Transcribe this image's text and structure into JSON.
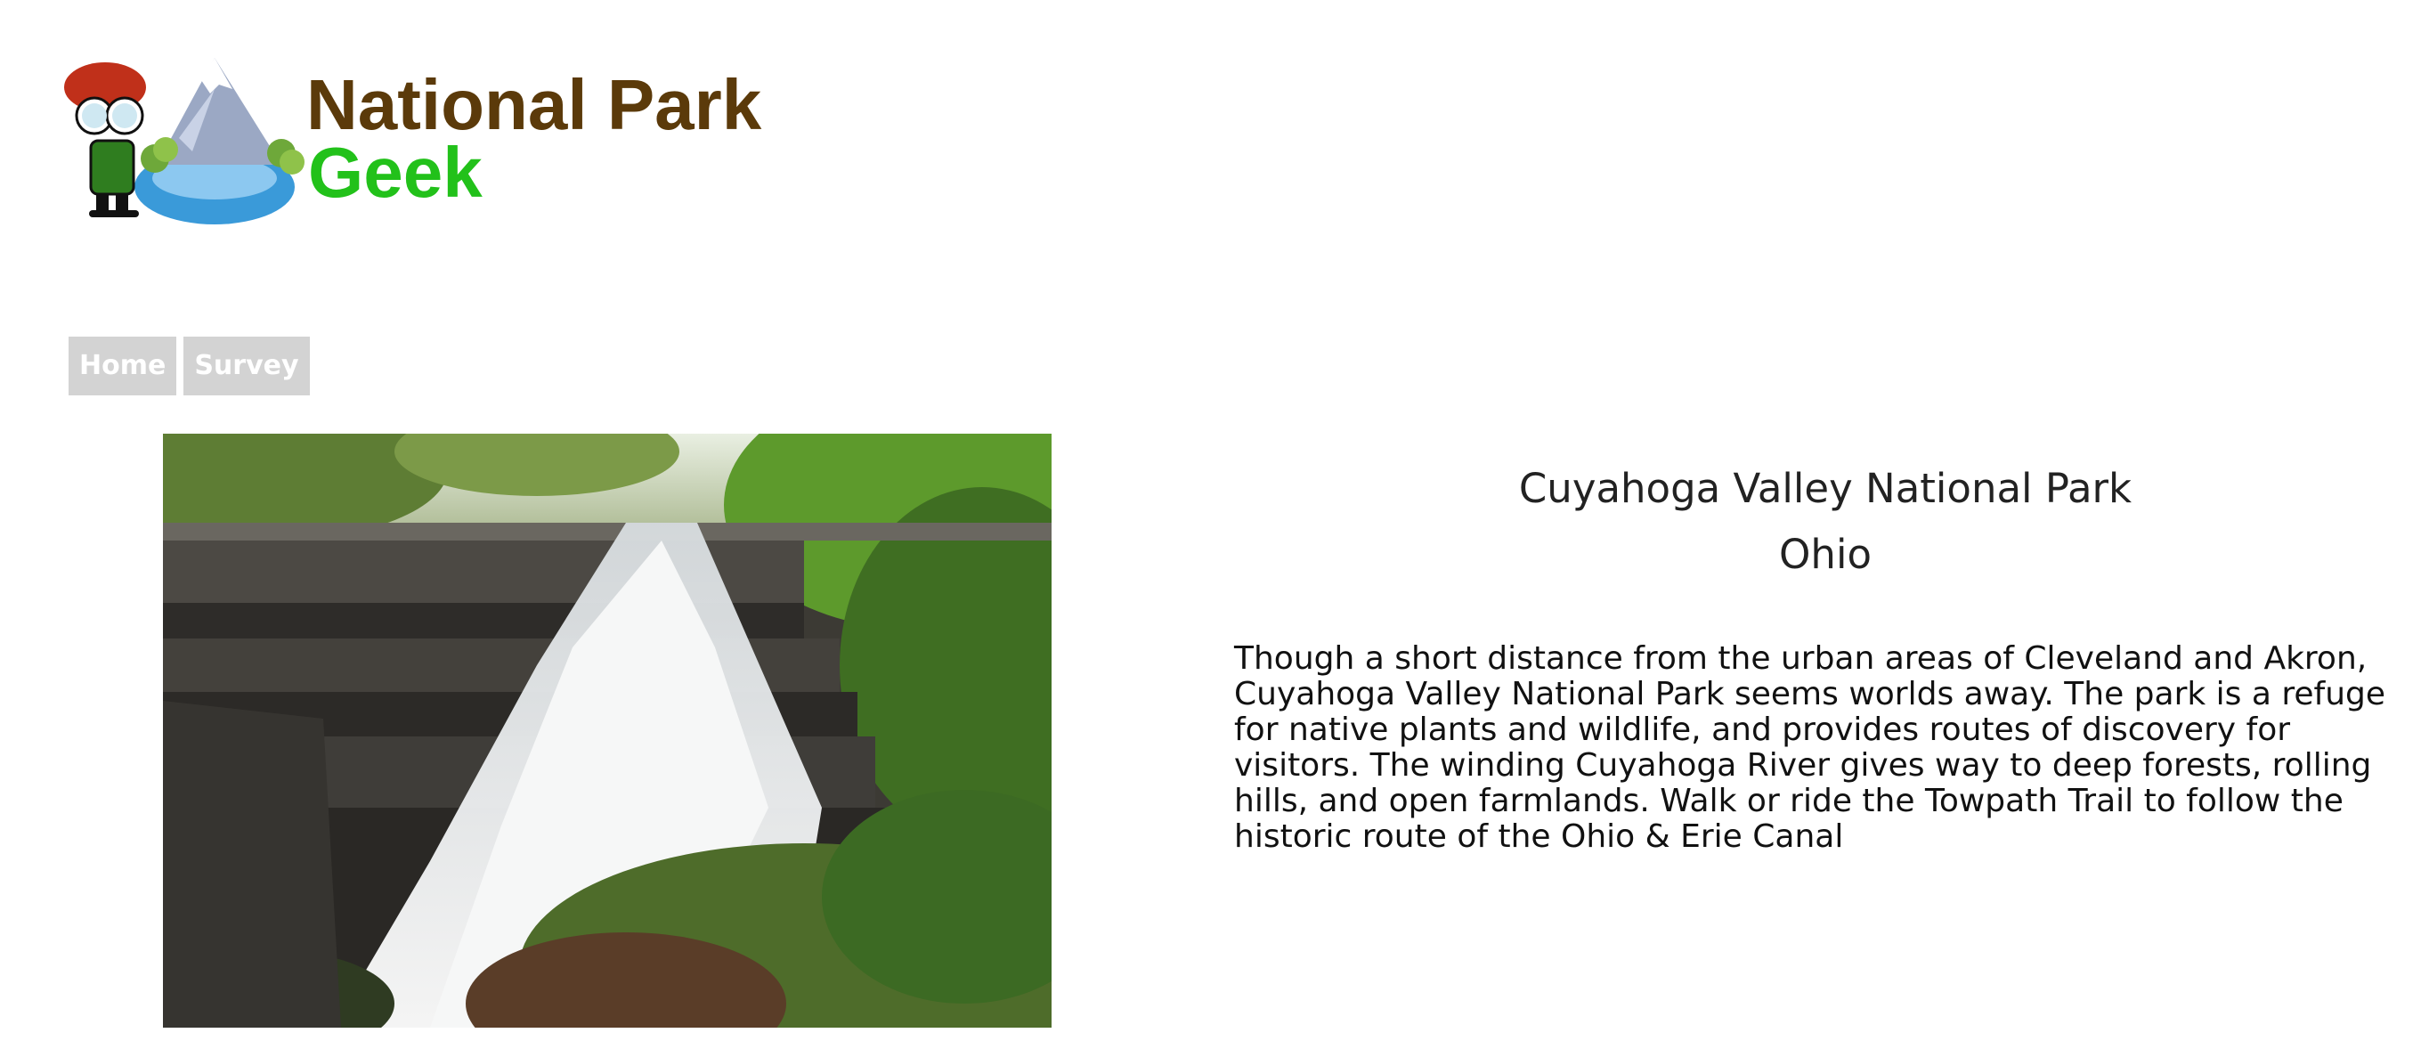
{
  "header": {
    "logo_line_1": "National Park",
    "logo_line_2": "Geek"
  },
  "nav": {
    "items": [
      {
        "label": "Home"
      },
      {
        "label": "Survey"
      }
    ]
  },
  "park": {
    "name": "Cuyahoga Valley National Park",
    "state": "Ohio",
    "description": "Though a short distance from the urban areas of Cleveland and Akron, Cuyahoga Valley National Park seems worlds away. The park is a refuge for native plants and wildlife, and provides routes of discovery for visitors. The winding Cuyahoga River gives way to deep forests, rolling hills, and open farmlands. Walk or ride the Towpath Trail to follow the historic route of the Ohio & Erie Canal"
  },
  "colors": {
    "logo_brown": "#5b3a0a",
    "logo_green": "#22c11a",
    "nav_bg": "#d3d3d3",
    "nav_text": "#ffffff"
  }
}
